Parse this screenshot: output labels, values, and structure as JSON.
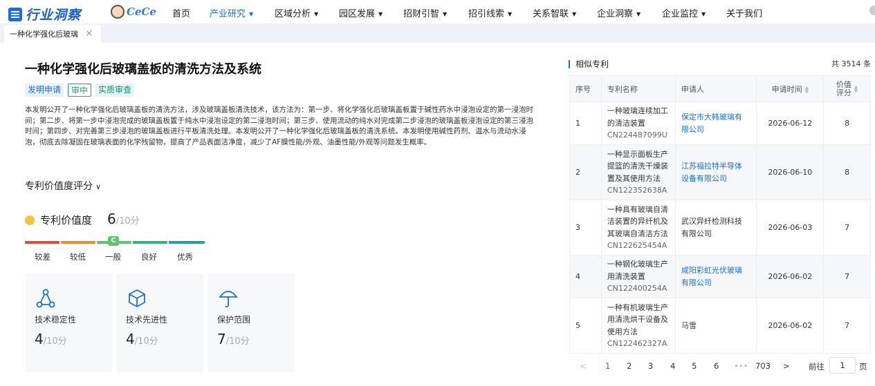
{
  "nav": {
    "logo_text": "行业洞察",
    "mascot_text": "CeCe",
    "items": [
      {
        "label": "首页",
        "caret": false,
        "active": false
      },
      {
        "label": "产业研究",
        "caret": true,
        "active": true
      },
      {
        "label": "区域分析",
        "caret": true,
        "active": false
      },
      {
        "label": "园区发展",
        "caret": true,
        "active": false
      },
      {
        "label": "招财引智",
        "caret": true,
        "active": false
      },
      {
        "label": "招引线索",
        "caret": true,
        "active": false
      },
      {
        "label": "关系智联",
        "caret": true,
        "active": false
      },
      {
        "label": "企业洞察",
        "caret": true,
        "active": false
      },
      {
        "label": "企业监控",
        "caret": true,
        "active": false
      },
      {
        "label": "关于我们",
        "caret": false,
        "active": false
      }
    ]
  },
  "tab": {
    "label": "一种化学强化后玻璃",
    "close": "×"
  },
  "patent": {
    "title": "一种化学强化后玻璃盖板的清洗方法及系统",
    "tags": [
      "发明申请",
      "审中",
      "实质审查"
    ],
    "abstract": "本发明公开了一种化学强化后玻璃盖板的清洗方法，涉及玻璃盖板清洗技术，该方法为：第一步、将化学强化后玻璃盖板置于碱性药水中浸泡设定的第一浸泡时间；第二步、将第一步中浸泡完成的玻璃盖板置于纯水中浸泡设定的第二浸泡时间；第三步、使用流动的纯水对完成第二步浸泡的玻璃盖板浸泡设定的第三浸泡时间；第四步、对完善第三步浸泡的玻璃盖板进行平板清洗处理。本发明公开了一种化学强化后玻璃盖板的清洗系统。本发明使用碱性药剂、温水与流动水浸泡，彻底去除凝固在玻璃表面的化学残留物，提高了产品表面洁净度，减少了AF膜性能/外观、油墨性能/外观等问题发生概率。"
  },
  "rating": {
    "section_title": "专利价值度评分",
    "chevron": "∨",
    "value_label": "专利价值度",
    "value": "6",
    "value_den": "/10分",
    "grade_marker": "C",
    "scale_labels": [
      "较差",
      "较低",
      "一般",
      "良好",
      "优秀"
    ],
    "scale_colors": [
      "#e94b35",
      "#f08a2c",
      "#5cc56e",
      "#2fb77d",
      "#21a39a"
    ],
    "cards": [
      {
        "icon": "triangle-nodes-icon",
        "label": "技术稳定性",
        "value": "4",
        "den": "/10分"
      },
      {
        "icon": "cube-icon",
        "label": "技术先进性",
        "value": "4",
        "den": "/10分"
      },
      {
        "icon": "umbrella-icon",
        "label": "保护范围",
        "value": "7",
        "den": "/10分"
      }
    ]
  },
  "similar": {
    "title": "相似专利",
    "total": "共 3514 条",
    "columns": [
      "序号",
      "专利名称",
      "申请人",
      "申请时间",
      "价值评分"
    ],
    "rows": [
      {
        "no": "1",
        "name": [
          "一种玻璃连续加工",
          "的清洁装置"
        ],
        "code": "CN224487099U",
        "applicant": [
          "保定市大韩玻璃有",
          "限公司"
        ],
        "link": true,
        "date": "2026-06-12",
        "score": "8"
      },
      {
        "no": "2",
        "name": [
          "一种显示面板生产",
          "提篮的清洗干燥装",
          "置及其使用方法"
        ],
        "code": "CN122352638A",
        "applicant": [
          "江苏福拉特半导体",
          "设备有限公司"
        ],
        "link": true,
        "date": "2026-06-10",
        "score": "8"
      },
      {
        "no": "3",
        "name": [
          "一种具有玻璃自清",
          "洁装置的异纤机及",
          "其玻璃自清洁方法"
        ],
        "code": "CN122625454A",
        "applicant": [
          "武汉异纤检测科技",
          "有限公司"
        ],
        "link": false,
        "date": "2026-06-03",
        "score": "7"
      },
      {
        "no": "4",
        "name": [
          "一种钢化玻璃生产",
          "用清洗装置"
        ],
        "code": "CN122400254A",
        "applicant": [
          "咸阳彩虹光伏玻璃",
          "有限公司"
        ],
        "link": true,
        "date": "2026-06-02",
        "score": "7"
      },
      {
        "no": "5",
        "name": [
          "一种有机玻璃生产",
          "用清洗烘干设备及",
          "使用方法"
        ],
        "code": "CN122462327A",
        "applicant": [
          "马雪"
        ],
        "link": false,
        "date": "2026-06-02",
        "score": "7"
      }
    ]
  },
  "pagination": {
    "prev": "<",
    "pages": [
      "1",
      "2",
      "3",
      "4",
      "5",
      "6"
    ],
    "current": "1",
    "ellipsis": "•••",
    "last": "703",
    "next": ">",
    "goto_prefix": "前往",
    "goto_value": "1",
    "goto_suffix": "页"
  }
}
